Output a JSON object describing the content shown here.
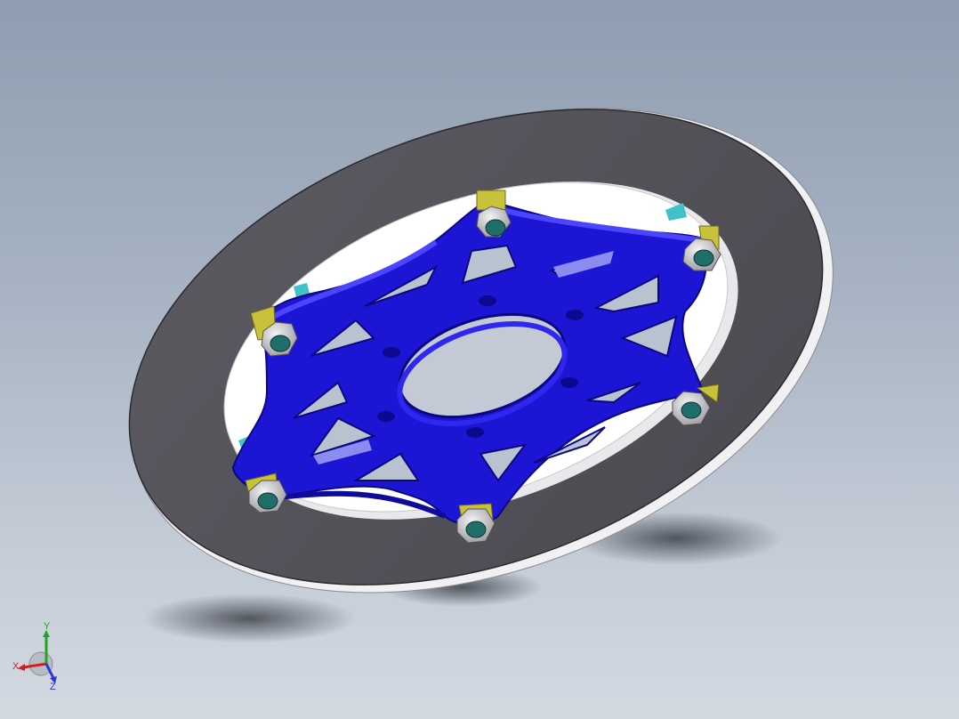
{
  "viewport": {
    "background_top": "#8e9db0",
    "background_bottom": "#d3d9e1"
  },
  "model": {
    "rotor_color": "#55535a",
    "rotor_edge_color": "#f2f2f4",
    "carrier_color": "#1a12d6",
    "carrier_highlight": "#4a44ff",
    "nut_color": "#c9c9cc",
    "spacer_color": "#c8c23a",
    "bolt_color": "#1f6e6a",
    "button_color": "#3fc2c9"
  },
  "triad": {
    "x_label": "X",
    "y_label": "Y",
    "z_label": "Z",
    "x_color": "#d21e1e",
    "y_color": "#1fa51f",
    "z_color": "#2a36d8"
  }
}
